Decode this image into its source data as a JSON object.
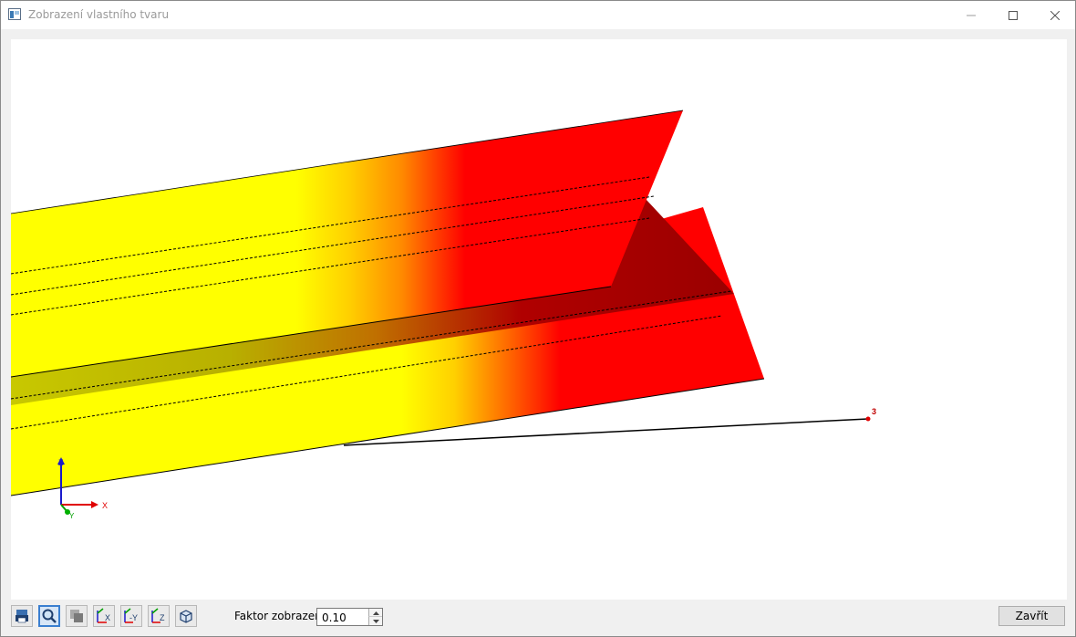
{
  "window": {
    "title": "Zobrazení vlastního tvaru"
  },
  "viewport": {
    "node_label": "3",
    "axes": {
      "x": "X",
      "y": "Y",
      "z": "Z"
    },
    "colors": {
      "high": "#ff0000",
      "low": "#ffff00",
      "shaded": "#9a0000"
    }
  },
  "toolbar": {
    "buttons": [
      {
        "icon": "print-icon"
      },
      {
        "icon": "zoom-icon",
        "active": true
      },
      {
        "icon": "render-mode-icon",
        "disabled": true
      },
      {
        "icon": "view-x-icon",
        "label": "X"
      },
      {
        "icon": "view-minus-y-icon",
        "label": "-Y"
      },
      {
        "icon": "view-z-icon",
        "label": "Z"
      },
      {
        "icon": "isometric-view-icon"
      }
    ],
    "factor_label": "Faktor zobrazení:",
    "factor_value": "0.10"
  },
  "footer": {
    "close_label": "Zavřít"
  }
}
